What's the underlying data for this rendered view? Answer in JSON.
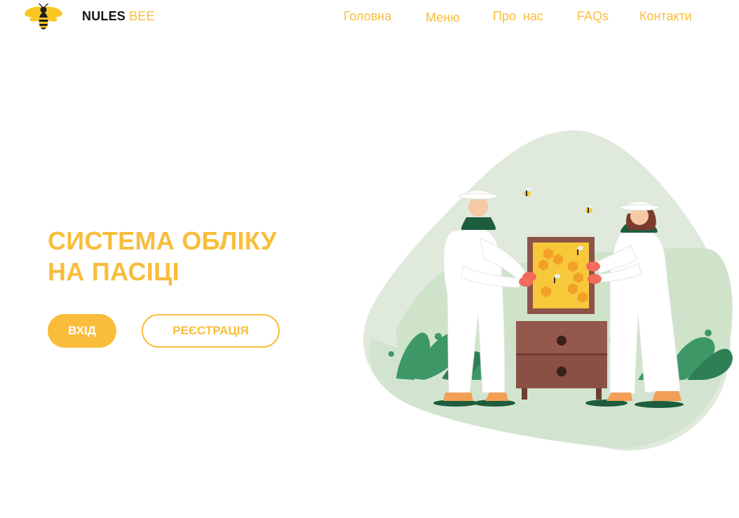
{
  "header": {
    "brand_primary": "NULES",
    "brand_secondary": "BEE",
    "logo_icon": "bee-icon",
    "nav": [
      {
        "label": "Головна"
      },
      {
        "label": "Меню"
      },
      {
        "label": "Про  нас"
      },
      {
        "label": "FAQs"
      },
      {
        "label": "Контакти"
      }
    ]
  },
  "hero": {
    "title_line1": "СИСТЕМА ОБЛІКУ",
    "title_line2": "НА ПАСІЦІ",
    "login_label": "ВХІД",
    "register_label": "РЕЄСТРАЦІЯ"
  },
  "colors": {
    "accent": "#f9bd3b",
    "text_dark": "#141414",
    "blob_green": "#d3e5cf",
    "leaf_green": "#3d9766"
  },
  "illustration": {
    "icon": "beekeepers-illustration"
  }
}
